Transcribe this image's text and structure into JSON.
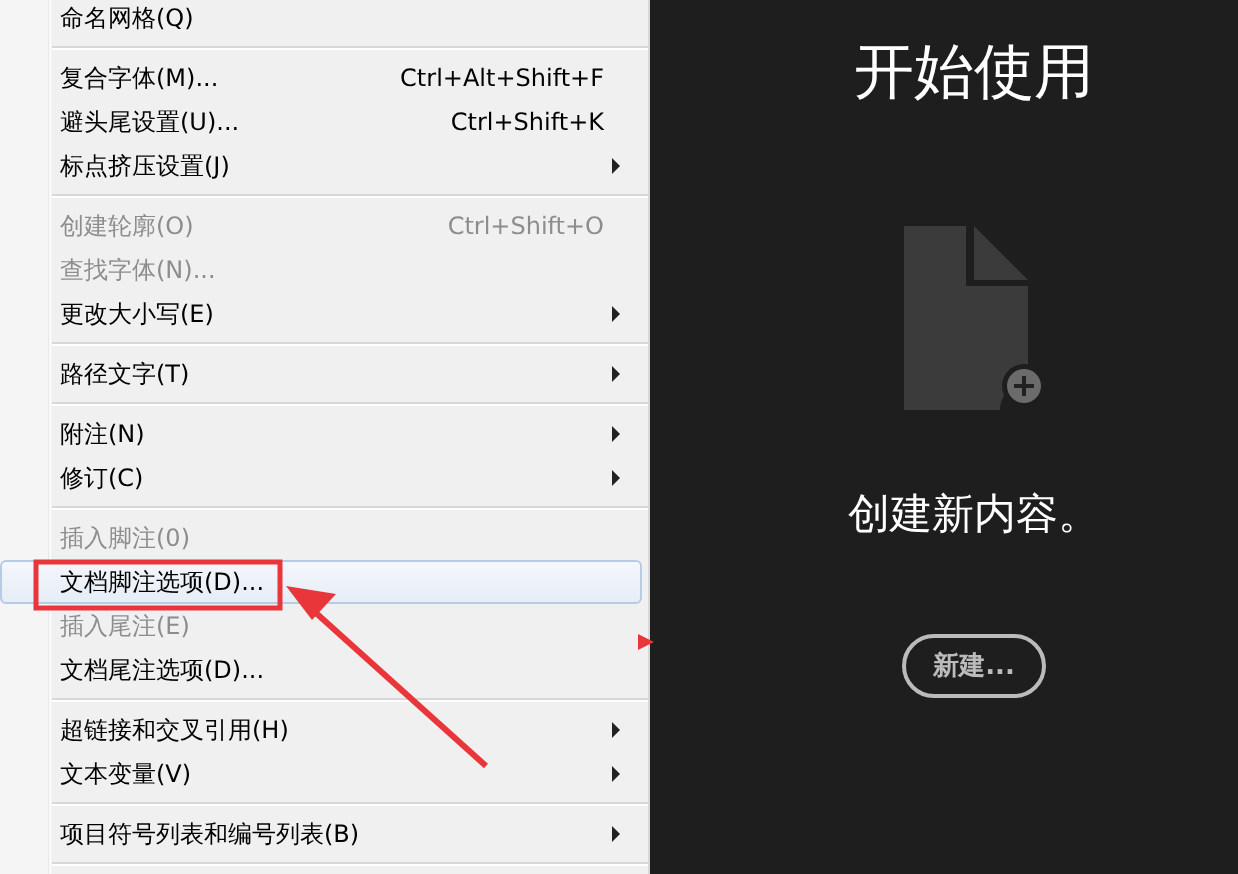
{
  "menu": {
    "groups": [
      {
        "items": [
          {
            "label": "命名网格(Q)",
            "submenu": false,
            "disabled": false,
            "selected": false
          }
        ]
      },
      {
        "items": [
          {
            "label": "复合字体(M)...",
            "shortcut": "Ctrl+Alt+Shift+F",
            "submenu": false,
            "disabled": false,
            "selected": false
          },
          {
            "label": "避头尾设置(U)...",
            "shortcut": "Ctrl+Shift+K",
            "submenu": false,
            "disabled": false,
            "selected": false
          },
          {
            "label": "标点挤压设置(J)",
            "submenu": true,
            "disabled": false,
            "selected": false
          }
        ]
      },
      {
        "items": [
          {
            "label": "创建轮廓(O)",
            "shortcut": "Ctrl+Shift+O",
            "submenu": false,
            "disabled": true,
            "selected": false
          },
          {
            "label": "查找字体(N)...",
            "submenu": false,
            "disabled": true,
            "selected": false
          },
          {
            "label": "更改大小写(E)",
            "submenu": true,
            "disabled": false,
            "selected": false
          }
        ]
      },
      {
        "items": [
          {
            "label": "路径文字(T)",
            "submenu": true,
            "disabled": false,
            "selected": false
          }
        ]
      },
      {
        "items": [
          {
            "label": "附注(N)",
            "submenu": true,
            "disabled": false,
            "selected": false
          },
          {
            "label": "修订(C)",
            "submenu": true,
            "disabled": false,
            "selected": false
          }
        ]
      },
      {
        "items": [
          {
            "label": "插入脚注(0)",
            "submenu": false,
            "disabled": true,
            "selected": false
          },
          {
            "label": "文档脚注选项(D)...",
            "submenu": false,
            "disabled": false,
            "selected": true
          },
          {
            "label": "插入尾注(E)",
            "submenu": false,
            "disabled": true,
            "selected": false
          },
          {
            "label": "文档尾注选项(D)...",
            "submenu": false,
            "disabled": false,
            "selected": false
          }
        ]
      },
      {
        "items": [
          {
            "label": "超链接和交叉引用(H)",
            "submenu": true,
            "disabled": false,
            "selected": false
          },
          {
            "label": "文本变量(V)",
            "submenu": true,
            "disabled": false,
            "selected": false
          }
        ]
      },
      {
        "items": [
          {
            "label": "项目符号列表和编号列表(B)",
            "submenu": true,
            "disabled": false,
            "selected": false
          }
        ]
      }
    ]
  },
  "start_panel": {
    "title": "开始使用",
    "message": "创建新内容。",
    "button": "新建..."
  }
}
